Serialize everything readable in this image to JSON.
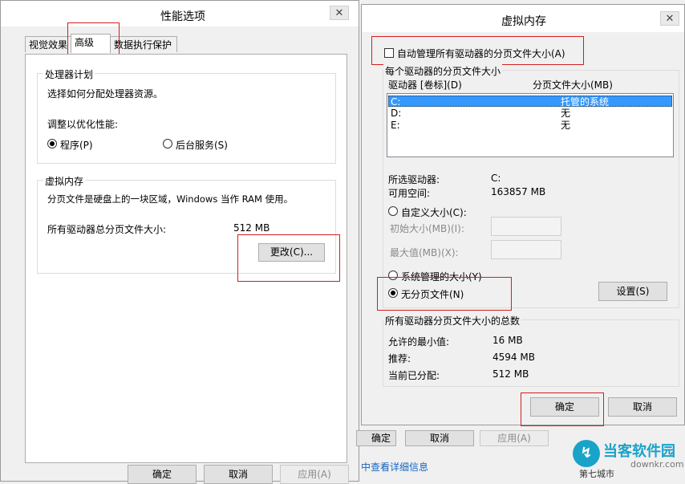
{
  "perf": {
    "title": "性能选项",
    "close": "✕",
    "tabs": [
      "视觉效果",
      "高级",
      "数据执行保护"
    ],
    "processor": {
      "legend": "处理器计划",
      "desc": "选择如何分配处理器资源。",
      "adjust": "调整以优化性能:",
      "opt_programs": "程序(P)",
      "opt_services": "后台服务(S)"
    },
    "vm": {
      "legend": "虚拟内存",
      "desc": "分页文件是硬盘上的一块区域，Windows 当作 RAM 使用。",
      "total_label": "所有驱动器总分页文件大小:",
      "total_value": "512 MB",
      "change_button": "更改(C)..."
    },
    "buttons": {
      "ok": "确定",
      "cancel": "取消",
      "apply": "应用(A)"
    }
  },
  "vmdialog": {
    "title": "虚拟内存",
    "close": "✕",
    "auto_manage": "自动管理所有驱动器的分页文件大小(A)",
    "group_legend": "每个驱动器的分页文件大小",
    "col_drive": "驱动器 [卷标](D)",
    "col_size": "分页文件大小(MB)",
    "drives": [
      {
        "drive": "C:",
        "size": "托管的系统"
      },
      {
        "drive": "D:",
        "size": "无"
      },
      {
        "drive": "E:",
        "size": "无"
      }
    ],
    "selected_label": "所选驱动器:",
    "selected_value": "C:",
    "free_label": "可用空间:",
    "free_value": "163857 MB",
    "custom_size": "自定义大小(C):",
    "initial_size": "初始大小(MB)(I):",
    "max_size": "最大值(MB)(X):",
    "system_managed": "系统管理的大小(Y)",
    "no_paging": "无分页文件(N)",
    "set_button": "设置(S)",
    "total_legend": "所有驱动器分页文件大小的总数",
    "min_label": "允许的最小值:",
    "min_value": "16 MB",
    "rec_label": "推荐:",
    "rec_value": "4594 MB",
    "cur_label": "当前已分配:",
    "cur_value": "512 MB",
    "ok": "确定",
    "cancel": "取消"
  },
  "background": {
    "ok_partial": "确定",
    "cancel": "取消",
    "apply": "应用(A)",
    "link": "中查看详细信息"
  },
  "watermark": {
    "brand": "当客软件园",
    "url": "downkr.com",
    "tag": "第七城市"
  },
  "colors": {
    "highlight": "#d21f1f",
    "selection": "#3399ff",
    "link": "#1565c0",
    "watermark": "#1aa3c9"
  }
}
